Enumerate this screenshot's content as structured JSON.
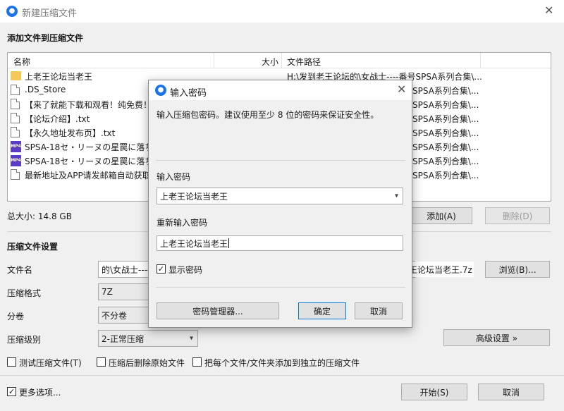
{
  "window": {
    "title": "新建压缩文件",
    "icon": "app-logo-icon"
  },
  "add_section": {
    "title": "添加文件到压缩文件"
  },
  "columns": {
    "name": "名称",
    "size": "大小",
    "path": "文件路径"
  },
  "files": [
    {
      "icon": "folder-icon",
      "name": "上老王论坛当老王",
      "path": "H:\\发到老王论坛的\\女战士----番号SPSA系列合集\\..."
    },
    {
      "icon": "file-icon",
      "name": ".DS_Store",
      "path": "SPSA系列合集\\..."
    },
    {
      "icon": "file-icon",
      "name": "【来了就能下载和观看！纯免费！",
      "path": "SPSA系列合集\\..."
    },
    {
      "icon": "file-icon",
      "name": "【论坛介绍】.txt",
      "path": "SPSA系列合集\\..."
    },
    {
      "icon": "file-icon",
      "name": "【永久地址发布页】.txt",
      "path": "SPSA系列合集\\..."
    },
    {
      "icon": "video-icon",
      "name": "SPSA-18セ・リーヌの星罠に落ち",
      "path": "SPSA系列合集\\..."
    },
    {
      "icon": "video-icon",
      "name": "SPSA-18セ・リーヌの星罠に落ち",
      "path": "SPSA系列合集\\..."
    },
    {
      "icon": "file-icon",
      "name": "最新地址及APP请发邮箱自动获取",
      "path": "SPSA系列合集\\..."
    }
  ],
  "total_size": "总大小: 14.8 GB",
  "buttons": {
    "add": "添加(A)",
    "delete": "删除(D)",
    "browse": "浏览(B)...",
    "advanced": "高级设置 »",
    "start": "开始(S)",
    "cancel": "取消"
  },
  "settings": {
    "title": "压缩文件设置",
    "filename_label": "文件名",
    "filename_left": "的\\女战士----",
    "filename_right": "王论坛当老王.7z",
    "format_label": "压缩格式",
    "format_value": "7Z",
    "split_label": "分卷",
    "split_value": "不分卷",
    "level_label": "压缩级别",
    "level_value": "2-正常压缩"
  },
  "options": {
    "test": "测试压缩文件(T)",
    "delete_after": "压缩后删除原始文件",
    "separate": "把每个文件/文件夹添加到独立的压缩文件",
    "more": "更多选项..."
  },
  "modal": {
    "title": "输入密码",
    "description": "输入压缩包密码。建议使用至少 8 位的密码来保证安全性。",
    "password_label": "输入密码",
    "password_value": "上老王论坛当老王",
    "repeat_label": "重新输入密码",
    "repeat_value": "上老王论坛当老王",
    "show_password": "显示密码",
    "manager_button": "密码管理器...",
    "ok_button": "确定",
    "cancel_button": "取消"
  }
}
